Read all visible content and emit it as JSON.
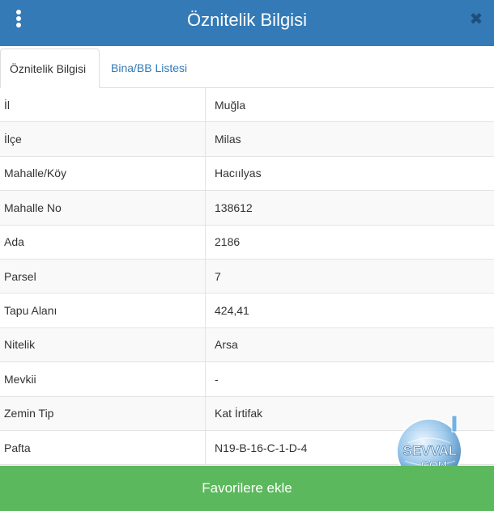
{
  "header": {
    "title": "Öznitelik Bilgisi",
    "icons": {
      "menu": "vertical-dots-icon",
      "close": "close-icon"
    },
    "close_glyph": "✖"
  },
  "tabs": [
    {
      "label": "Öznitelik Bilgisi",
      "active": true
    },
    {
      "label": "Bina/BB Listesi",
      "active": false
    }
  ],
  "attributes": [
    {
      "label": "İl",
      "value": "Muğla"
    },
    {
      "label": "İlçe",
      "value": "Milas"
    },
    {
      "label": "Mahalle/Köy",
      "value": "Hacıılyas"
    },
    {
      "label": "Mahalle No",
      "value": "138612"
    },
    {
      "label": "Ada",
      "value": "2186"
    },
    {
      "label": "Parsel",
      "value": "7"
    },
    {
      "label": "Tapu Alanı",
      "value": "424,41"
    },
    {
      "label": "Nitelik",
      "value": "Arsa"
    },
    {
      "label": "Mevkii",
      "value": "-"
    },
    {
      "label": "Zemin Tip",
      "value": "Kat İrtifak"
    },
    {
      "label": "Pafta",
      "value": "N19-B-16-C-1-D-4"
    }
  ],
  "footer": {
    "button_label": "Favorilere ekle"
  },
  "watermark": {
    "text_top": "SEVVAL",
    "text_bottom": ".COM"
  },
  "colors": {
    "header_bg": "#337ab7",
    "tab_link": "#337ab7",
    "footer_bg": "#5cb85c",
    "close_icon": "#1f4e79"
  }
}
